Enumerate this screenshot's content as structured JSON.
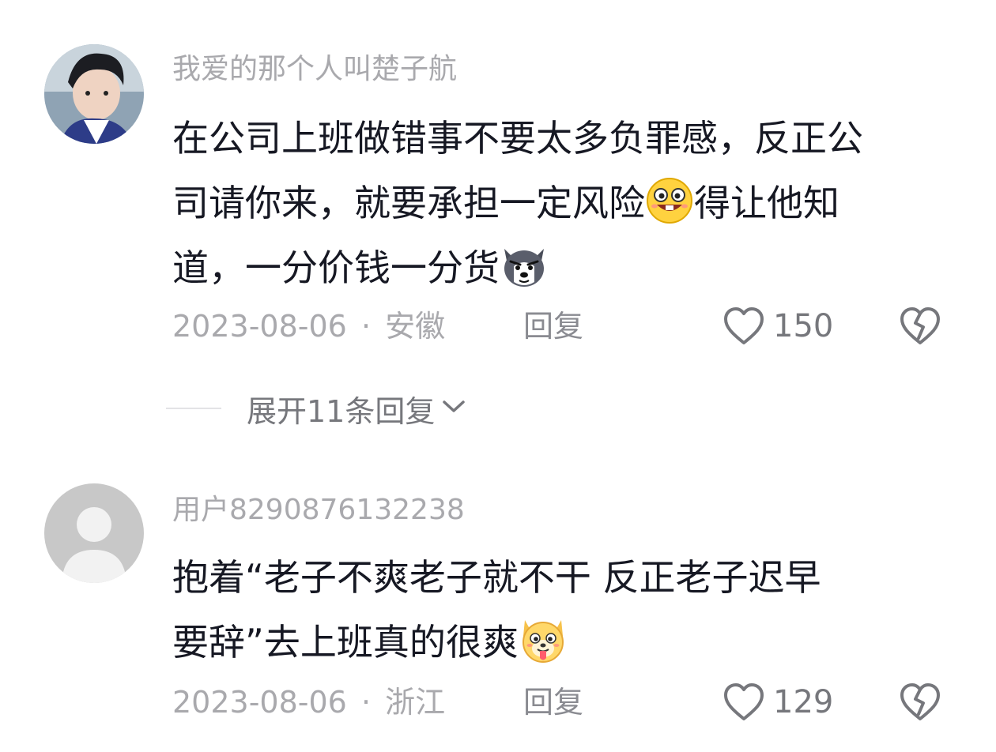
{
  "comments": [
    {
      "username": "我爱的那个人叫楚子航",
      "lines": [
        [
          "在公司上班做错事不要太多负罪感，反正公",
          ""
        ],
        [
          "司请你来，就要承担一定风险",
          "得让他知"
        ],
        [
          "道，一分价钱一分货",
          ""
        ]
      ],
      "emojis": [
        "grin-emoji",
        "husky-emoji"
      ],
      "date": "2023-08-06",
      "separator": "·",
      "location": "安徽",
      "reply_label": "回复",
      "like_count": "150",
      "expand_label": "展开11条回复"
    },
    {
      "username": "用户8290876132238",
      "lines": [
        [
          "抱着“老子不爽老子就不干 反正老子迟早",
          ""
        ],
        [
          "要辞”去上班真的很爽",
          ""
        ]
      ],
      "emojis": [
        "tongue-dog-emoji"
      ],
      "date": "2023-08-06",
      "separator": "·",
      "location": "浙江",
      "reply_label": "回复",
      "like_count": "129"
    }
  ],
  "colors": {
    "username": "#a9a9ad",
    "body": "#161823",
    "meta": "#a9a9ad",
    "icon": "#76777c"
  }
}
